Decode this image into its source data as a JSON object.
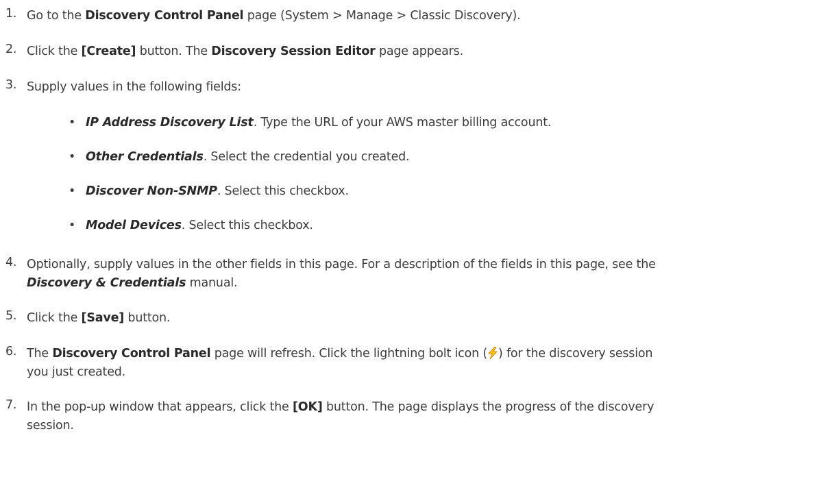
{
  "steps": [
    {
      "num": "1.",
      "t1": "Go to the ",
      "b1": "Discovery Control Panel",
      "t2": " page (System > Manage > Classic Discovery)."
    },
    {
      "num": "2.",
      "t1": "Click the ",
      "b1": "[Create]",
      "t2": " button. The ",
      "b2": "Discovery Session Editor",
      "t3": " page appears."
    },
    {
      "num": "3.",
      "t1": "Supply values in the following fields:"
    },
    {
      "num": "4.",
      "t1": "Optionally, supply values in the other fields in this page. For a description of the fields in this page, see the",
      "i1": "Discovery & Credentials",
      "t2": " manual."
    },
    {
      "num": "5.",
      "t1": "Click the ",
      "b1": "[Save]",
      "t2": " button."
    },
    {
      "num": "6.",
      "t1": "The ",
      "b1": "Discovery Control Panel",
      "t2": " page will refresh. Click the lightning bolt icon (",
      "t3": ") for the discovery session",
      "t4": "you just created."
    },
    {
      "num": "7.",
      "t1": "In the pop-up window that appears, click the ",
      "b1": "[OK]",
      "t2": " button. The page displays the progress of the discovery",
      "t3": "session."
    }
  ],
  "bullets": [
    {
      "dot": "•",
      "field": "IP Address Discovery List",
      "text": ". Type the URL of your AWS master billing account."
    },
    {
      "dot": "•",
      "field": "Other Credentials",
      "text": ". Select the credential you created."
    },
    {
      "dot": "•",
      "field": "Discover Non-SNMP",
      "text": ". Select this checkbox."
    },
    {
      "dot": "•",
      "field": "Model Devices",
      "text": ". Select this checkbox."
    }
  ],
  "icon": "lightning-bolt-icon",
  "colors": {
    "text": "#3c3c3c",
    "bolt_yellow": "#f5c518",
    "bolt_orange": "#e08a00"
  }
}
